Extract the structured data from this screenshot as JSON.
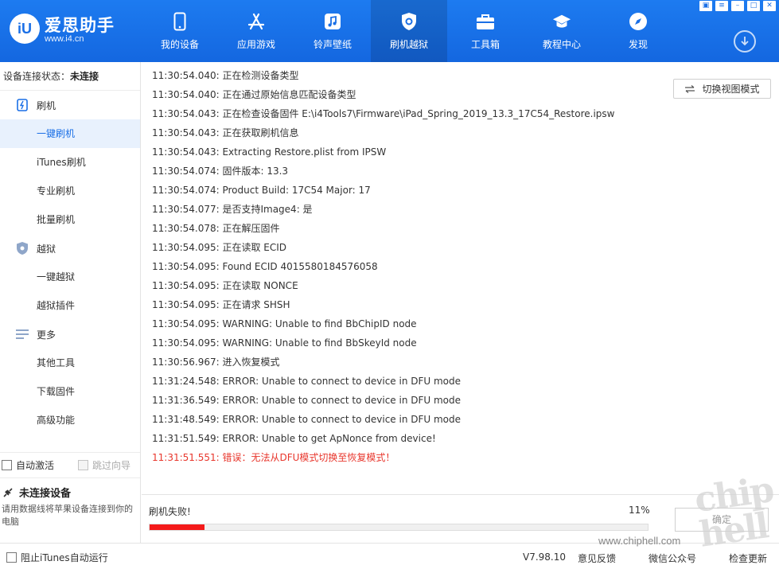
{
  "app": {
    "logo_mark": "iU",
    "name": "爱思助手",
    "url": "www.i4.cn"
  },
  "nav": [
    {
      "label": "我的设备",
      "icon": "phone-icon"
    },
    {
      "label": "应用游戏",
      "icon": "app-store-icon"
    },
    {
      "label": "铃声壁纸",
      "icon": "music-note-icon"
    },
    {
      "label": "刷机越狱",
      "icon": "shield-gear-icon",
      "active": true
    },
    {
      "label": "工具箱",
      "icon": "toolbox-icon"
    },
    {
      "label": "教程中心",
      "icon": "graduation-cap-icon"
    },
    {
      "label": "发现",
      "icon": "compass-icon"
    }
  ],
  "window_buttons": [
    "shirt-icon",
    "menu-icon",
    "minimize-icon",
    "maximize-icon",
    "close-icon"
  ],
  "window_button_glyphs": [
    "▣",
    "≡",
    "–",
    "□",
    "✕"
  ],
  "sidebar": {
    "status_label": "设备连接状态：",
    "status_value": "未连接",
    "groups": [
      {
        "label": "刷机",
        "icon": "flash-icon",
        "items": [
          "一键刷机",
          "iTunes刷机",
          "专业刷机",
          "批量刷机"
        ]
      },
      {
        "label": "越狱",
        "icon": "shield-icon",
        "items": [
          "一键越狱",
          "越狱插件"
        ]
      },
      {
        "label": "更多",
        "icon": "list-icon",
        "items": [
          "其他工具",
          "下载固件",
          "高级功能"
        ]
      }
    ],
    "active_item": "一键刷机",
    "auto_activate": "自动激活",
    "skip_guide": "跳过向导",
    "device_title": "未连接设备",
    "device_desc": "请用数据线将苹果设备连接到你的电脑"
  },
  "main": {
    "switch_view": "切换视图模式",
    "log": [
      {
        "text": "11:30:54.040:  正在检测设备类型",
        "error": false
      },
      {
        "text": "11:30:54.040:  正在通过原始信息匹配设备类型",
        "error": false
      },
      {
        "text": "11:30:54.043:  正在检查设备固件 E:\\i4Tools7\\Firmware\\iPad_Spring_2019_13.3_17C54_Restore.ipsw",
        "error": false
      },
      {
        "text": "11:30:54.043:  正在获取刷机信息",
        "error": false
      },
      {
        "text": "11:30:54.043:  Extracting Restore.plist from IPSW",
        "error": false
      },
      {
        "text": "11:30:54.074:  固件版本: 13.3",
        "error": false
      },
      {
        "text": "11:30:54.074:  Product Build: 17C54 Major: 17",
        "error": false
      },
      {
        "text": "11:30:54.077:  是否支持Image4: 是",
        "error": false
      },
      {
        "text": "11:30:54.078:  正在解压固件",
        "error": false
      },
      {
        "text": "11:30:54.095:  正在读取 ECID",
        "error": false
      },
      {
        "text": "11:30:54.095:  Found ECID 4015580184576058",
        "error": false
      },
      {
        "text": "11:30:54.095:  正在读取 NONCE",
        "error": false
      },
      {
        "text": "11:30:54.095:  正在请求 SHSH",
        "error": false
      },
      {
        "text": "11:30:54.095:  WARNING: Unable to find BbChipID node",
        "error": false
      },
      {
        "text": "11:30:54.095:  WARNING: Unable to find BbSkeyId node",
        "error": false
      },
      {
        "text": "11:30:56.967:  进入恢复模式",
        "error": false
      },
      {
        "text": "11:31:24.548:  ERROR: Unable to connect to device in DFU mode",
        "error": false
      },
      {
        "text": "11:31:36.549:  ERROR: Unable to connect to device in DFU mode",
        "error": false
      },
      {
        "text": "11:31:48.549:  ERROR: Unable to connect to device in DFU mode",
        "error": false
      },
      {
        "text": "11:31:51.549:  ERROR: Unable to get ApNonce from device!",
        "error": false
      },
      {
        "text": "11:31:51.551:  错误：无法从DFU模式切换至恢复模式！",
        "error": true
      }
    ]
  },
  "progress": {
    "status": "刷机失败!",
    "percent_label": "11%",
    "fraction": 0.11,
    "bar_color": "#f41a1a",
    "confirm": "确定"
  },
  "statusbar": {
    "block_itunes": "阻止iTunes自动运行",
    "version": "V7.98.10",
    "feedback": "意见反馈",
    "wechat": "微信公众号",
    "update": "检查更新"
  },
  "watermark": {
    "text": "chip hell",
    "url": "www.chiphell.com"
  },
  "colors": {
    "brand": "#1a6fe6",
    "error": "#e8362c"
  }
}
